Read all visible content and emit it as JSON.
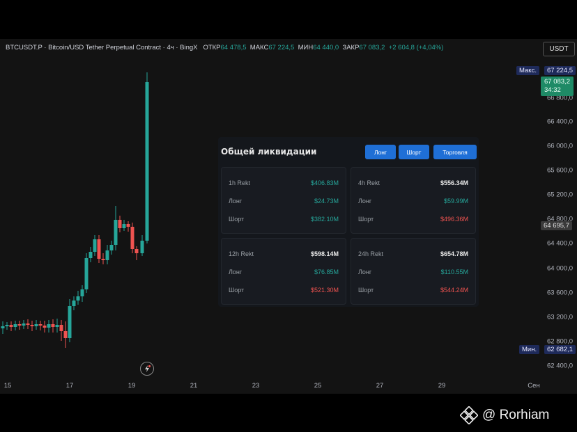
{
  "header": {
    "symbol": "BTCUSDT.P",
    "name": "Bitcoin/USD Tether Perpetual Contract",
    "interval": "4ч",
    "exchange": "BingX",
    "open_label": "ОТКР",
    "open_value": "64 478,5",
    "high_label": "МАКС",
    "high_value": "67 224,5",
    "low_label": "МИН",
    "low_value": "64 440,0",
    "close_label": "ЗАКР",
    "close_value": "67 083,2",
    "change": "+2 604,8 (+4,04%)"
  },
  "currency_button": "USDT",
  "price_axis": {
    "labels": [
      "66 800,0",
      "66 400,0",
      "66 000,0",
      "65 600,0",
      "65 200,0",
      "64 800,0",
      "64 400,0",
      "64 000,0",
      "63 600,0",
      "63 200,0",
      "62 800,0",
      "62 400,0"
    ],
    "max_label": "Макс.",
    "max_value": "67 224,5",
    "current_price": "67 083,2",
    "countdown": "34:32",
    "crosshair_price": "64 695,7",
    "min_label": "Мин.",
    "min_value": "62 682,1"
  },
  "time_axis": [
    "15",
    "17",
    "19",
    "21",
    "23",
    "25",
    "27",
    "29",
    "Сен"
  ],
  "liquidation_panel": {
    "title": "Общей ликвидации",
    "buttons": [
      "Лонг",
      "Шорт",
      "Торговля"
    ],
    "cards": [
      {
        "period": "1h Rekt",
        "total": "$406.83M",
        "long_label": "Лонг",
        "long": "$24.73M",
        "short_label": "Шорт",
        "short": "$382.10M"
      },
      {
        "period": "4h Rekt",
        "total": "$556.34M",
        "long_label": "Лонг",
        "long": "$59.99M",
        "short_label": "Шорт",
        "short": "$496.36M"
      },
      {
        "period": "12h Rekt",
        "total": "$598.14M",
        "long_label": "Лонг",
        "long": "$76.85M",
        "short_label": "Шорт",
        "short": "$521.30M"
      },
      {
        "period": "24h Rekt",
        "total": "$654.78M",
        "long_label": "Лонг",
        "long": "$110.55M",
        "short_label": "Шорт",
        "short": "$544.24M"
      }
    ]
  },
  "colors": {
    "up": "#26a69a",
    "down": "#ef5350",
    "background": "#131313",
    "accent_button": "#1f6fd6"
  },
  "watermark": "@ Rorhiam"
}
